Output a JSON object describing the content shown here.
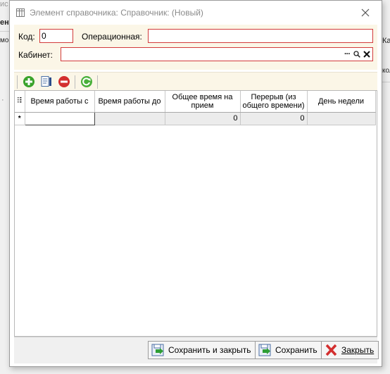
{
  "background": {
    "frag_top": "ис",
    "frag_left_bold": "ен",
    "frag_left_col": "мо",
    "frag_right_1": "Ка",
    "frag_right_2": "кол"
  },
  "window": {
    "title": "Элемент справочника: Справочник: (Новый)"
  },
  "form": {
    "code_label": "Код:",
    "code_value": "0",
    "operational_label": "Операционная:",
    "operational_value": "",
    "cabinet_label": "Кабинет:",
    "cabinet_value": "",
    "cabinet_choose_glyph": "···"
  },
  "toolbar": {
    "add": "add-icon",
    "edit": "edit-icon",
    "delete": "delete-icon",
    "refresh": "refresh-icon"
  },
  "grid": {
    "columns": [
      "Время работы с",
      "Время работы до",
      "Общее время на прием",
      "Перерыв (из общего времени)",
      "День недели"
    ],
    "new_row_marker": "*",
    "rows": [
      {
        "from": "",
        "to": "",
        "total": "0",
        "break": "0",
        "day": ""
      }
    ]
  },
  "buttons": {
    "save_close": "Сохранить и закрыть",
    "save": "Сохранить",
    "close": "Закрыть"
  },
  "colors": {
    "form_bg": "#fbf6e7",
    "required_border": "#d23b3b",
    "add_green": "#3aa32b",
    "delete_red": "#d32f2f"
  }
}
